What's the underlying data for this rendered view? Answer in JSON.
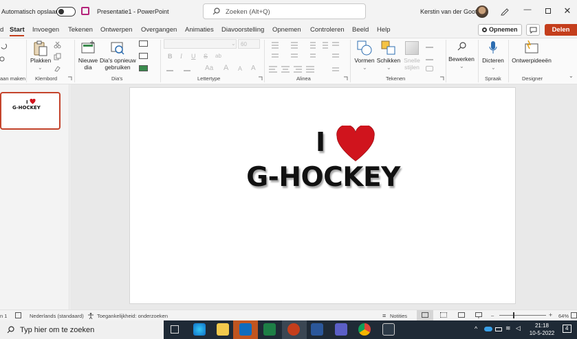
{
  "titlebar": {
    "autosave_label": "Automatisch opslaan",
    "doc_title": "Presentatie1  -  PowerPoint",
    "search_placeholder": "Zoeken (Alt+Q)",
    "user_name": "Kerstin van der Goot",
    "colors": {
      "accent": "#c43e1c",
      "save_icon": "#b4227a"
    }
  },
  "tabs": [
    {
      "label": "d",
      "active": false
    },
    {
      "label": "Start",
      "active": true
    },
    {
      "label": "Invoegen"
    },
    {
      "label": "Tekenen"
    },
    {
      "label": "Ontwerpen"
    },
    {
      "label": "Overgangen"
    },
    {
      "label": "Animaties"
    },
    {
      "label": "Diavoorstelling"
    },
    {
      "label": "Opnemen"
    },
    {
      "label": "Controleren"
    },
    {
      "label": "Beeld"
    },
    {
      "label": "Help"
    }
  ],
  "actions": {
    "record_label": "Opnemen",
    "share_label": "Delen"
  },
  "ribbon": {
    "groups": {
      "undo": "aan maken",
      "clipboard": "Klembord",
      "slides": "Dia's",
      "font": "Lettertype",
      "paragraph": "Alinea",
      "drawing": "Tekenen",
      "voice": "Spraak",
      "designer": "Designer"
    },
    "paste_label": "Plakken",
    "new_slide_label": [
      "Nieuwe",
      "dia"
    ],
    "reuse_label": [
      "Dia's opnieuw",
      "gebruiken"
    ],
    "font_size": "60",
    "format_buttons": [
      "B",
      "I",
      "U",
      "S",
      "ab"
    ],
    "shapes_label": "Vormen",
    "arrange_label": "Schikken",
    "quickstyles_label": [
      "Snelle",
      "stijlen"
    ],
    "edit_label": "Bewerken",
    "dictate_label": "Dicteren",
    "design_ideas_label": "Ontwerpideeën"
  },
  "slide": {
    "line1": "I",
    "line2": "G-HOCKEY",
    "heart_color": "#d0141d"
  },
  "thumbnail": {
    "line1": "I",
    "line2": "G-HOCKEY"
  },
  "statusbar": {
    "slide_num": "n 1",
    "language": "Nederlands (standaard)",
    "accessibility": "Toegankelijkheid: onderzoeken",
    "notes": "Notities",
    "zoom": "64%"
  },
  "taskbar": {
    "search_placeholder": "Typ hier om te zoeken",
    "time": "21:18",
    "date": "10-5-2022",
    "notification_count": "4"
  }
}
